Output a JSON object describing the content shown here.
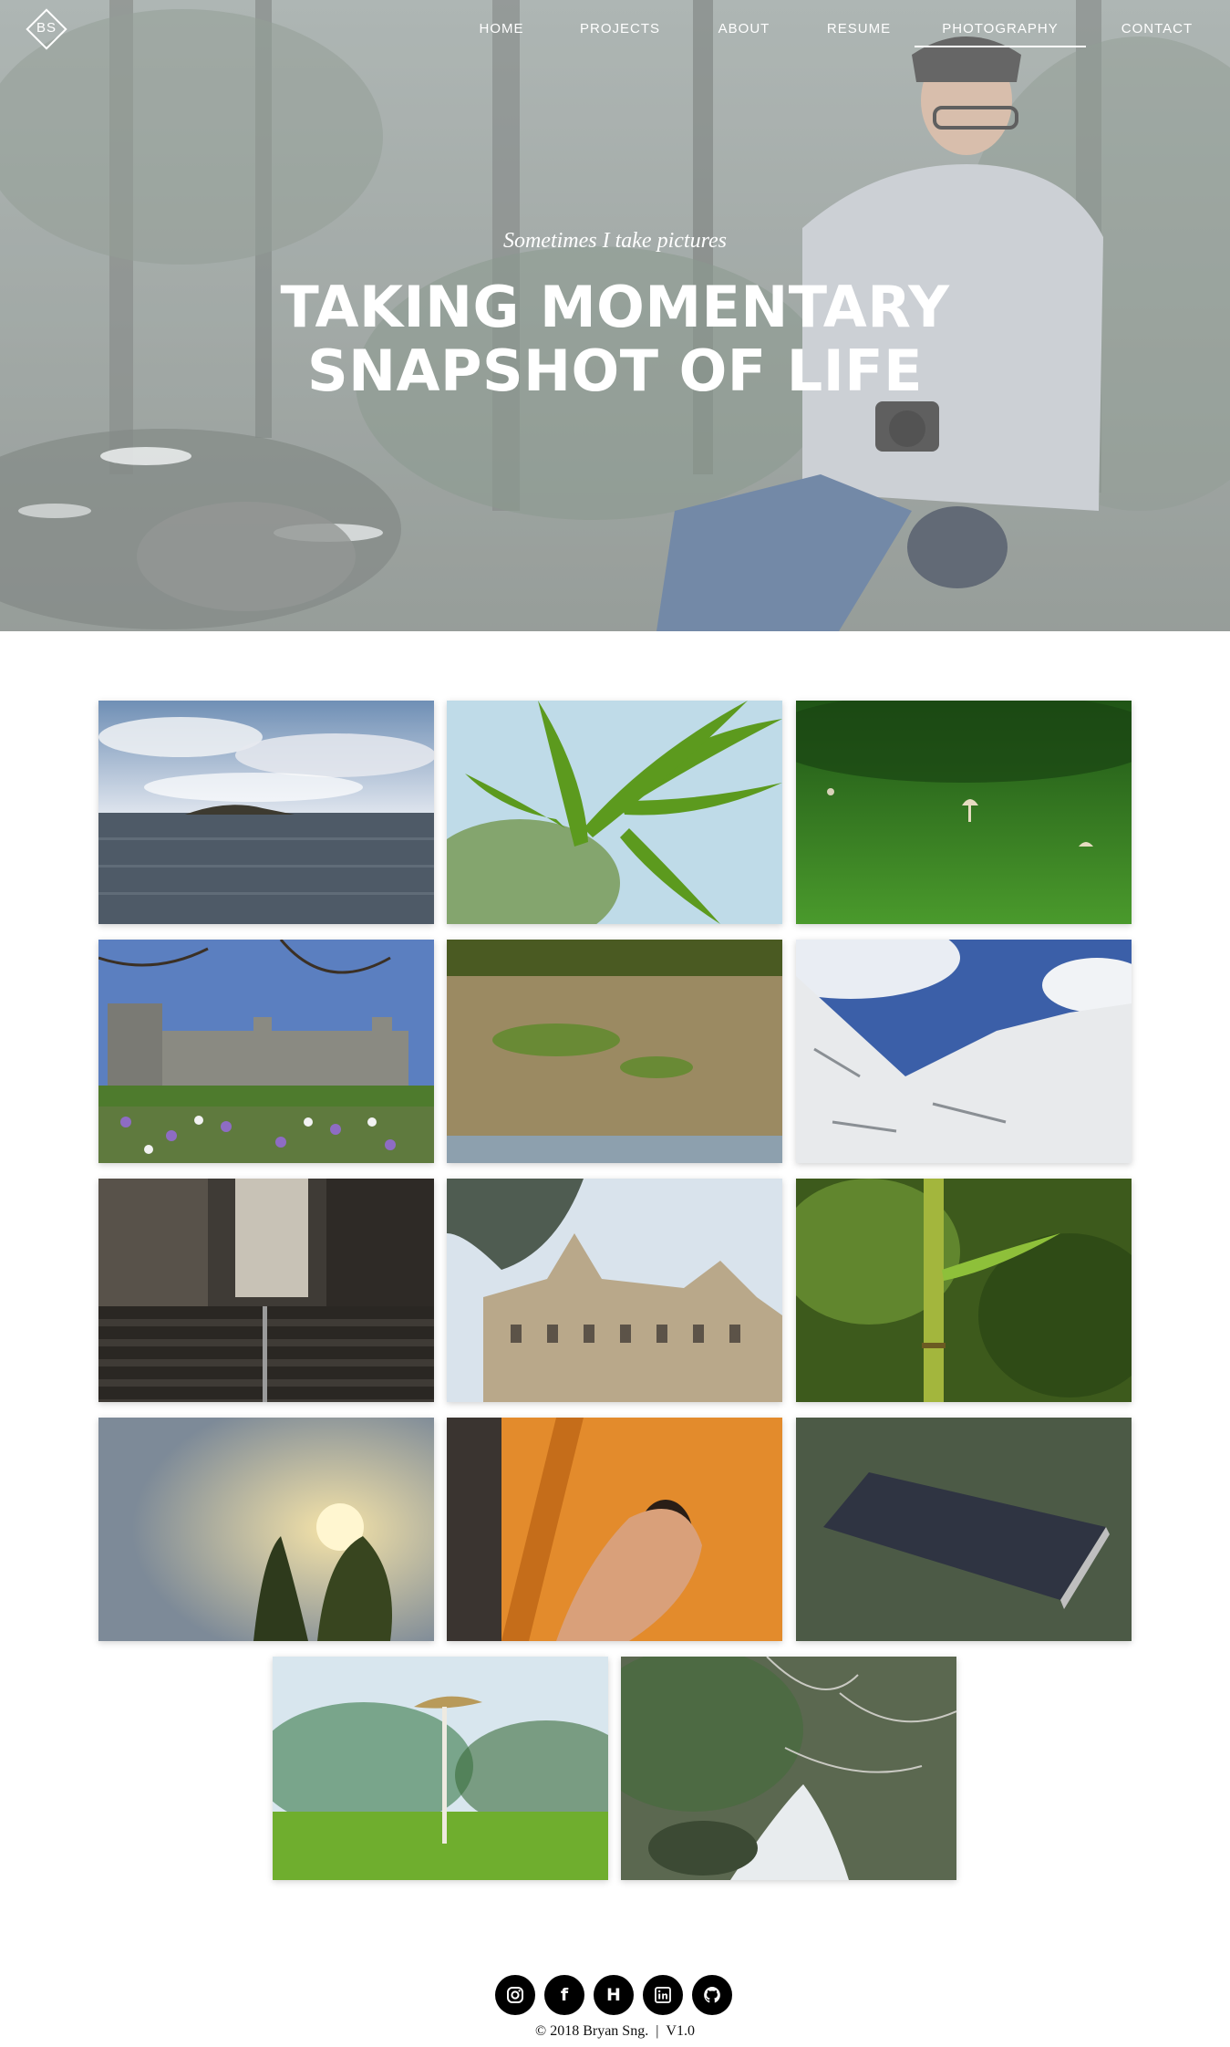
{
  "logo": {
    "text": "BS"
  },
  "nav": {
    "items": [
      {
        "label": "HOME",
        "active": false
      },
      {
        "label": "PROJECTS",
        "active": false
      },
      {
        "label": "ABOUT",
        "active": false
      },
      {
        "label": "RESUME",
        "active": false
      },
      {
        "label": "PHOTOGRAPHY",
        "active": true
      },
      {
        "label": "CONTACT",
        "active": false
      }
    ]
  },
  "hero": {
    "tagline": "Sometimes I take pictures",
    "headline_line1": "TAKING MOMENTARY",
    "headline_line2": "SNAPSHOT OF LIFE"
  },
  "gallery": {
    "photos": [
      {
        "subject": "sea-island"
      },
      {
        "subject": "bamboo-leaves"
      },
      {
        "subject": "grass-mushrooms"
      },
      {
        "subject": "castle-crocus"
      },
      {
        "subject": "ground-closeup"
      },
      {
        "subject": "snowy-mountains"
      },
      {
        "subject": "stone-stairs"
      },
      {
        "subject": "gothic-building"
      },
      {
        "subject": "bamboo-stalk"
      },
      {
        "subject": "sunset-trees"
      },
      {
        "subject": "hand-orange-wall"
      },
      {
        "subject": "smartphone"
      },
      {
        "subject": "single-mushroom"
      },
      {
        "subject": "forest-stream"
      }
    ]
  },
  "footer": {
    "social": [
      {
        "icon": "instagram-icon"
      },
      {
        "icon": "facebook-icon",
        "glyph": "f"
      },
      {
        "icon": "hashnode-icon",
        "glyph": "H"
      },
      {
        "icon": "linkedin-icon"
      },
      {
        "icon": "github-icon"
      }
    ],
    "copyright": "© 2018 Bryan Sng.",
    "separator": "|",
    "version": "V1.0"
  }
}
